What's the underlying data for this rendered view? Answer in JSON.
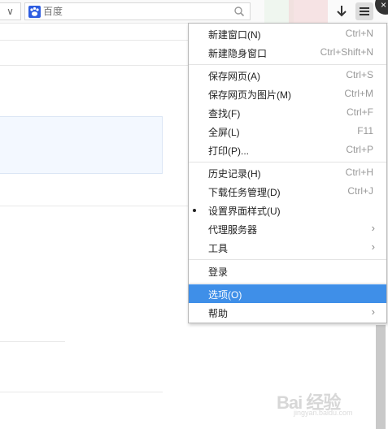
{
  "toolbar": {
    "search_placeholder": "百度",
    "dropdown_glyph": "∨",
    "close_glyph": "×"
  },
  "menu": {
    "items": [
      {
        "label": "新建窗口(N)",
        "shortcut": "Ctrl+N"
      },
      {
        "label": "新建隐身窗口",
        "shortcut": "Ctrl+Shift+N"
      },
      {
        "label": "保存网页(A)",
        "shortcut": "Ctrl+S"
      },
      {
        "label": "保存网页为图片(M)",
        "shortcut": "Ctrl+M"
      },
      {
        "label": "查找(F)",
        "shortcut": "Ctrl+F"
      },
      {
        "label": "全屏(L)",
        "shortcut": "F11"
      },
      {
        "label": "打印(P)...",
        "shortcut": "Ctrl+P"
      },
      {
        "label": "历史记录(H)",
        "shortcut": "Ctrl+H"
      },
      {
        "label": "下载任务管理(D)",
        "shortcut": "Ctrl+J"
      },
      {
        "label": "设置界面样式(U)",
        "shortcut": ""
      },
      {
        "label": "代理服务器",
        "shortcut": "",
        "submenu_glyph": "›"
      },
      {
        "label": "工具",
        "shortcut": "",
        "submenu_glyph": "›"
      },
      {
        "label": "登录",
        "shortcut": ""
      },
      {
        "label": "选项(O)",
        "shortcut": "",
        "highlighted": true
      },
      {
        "label": "帮助",
        "shortcut": "",
        "submenu_glyph": "›"
      }
    ]
  },
  "watermark": {
    "text": "Bai 经验",
    "sub": "jingyan.baidu.com"
  },
  "colors": {
    "highlight": "#3f8fe8",
    "baidu_blue": "#2d5ce0"
  }
}
